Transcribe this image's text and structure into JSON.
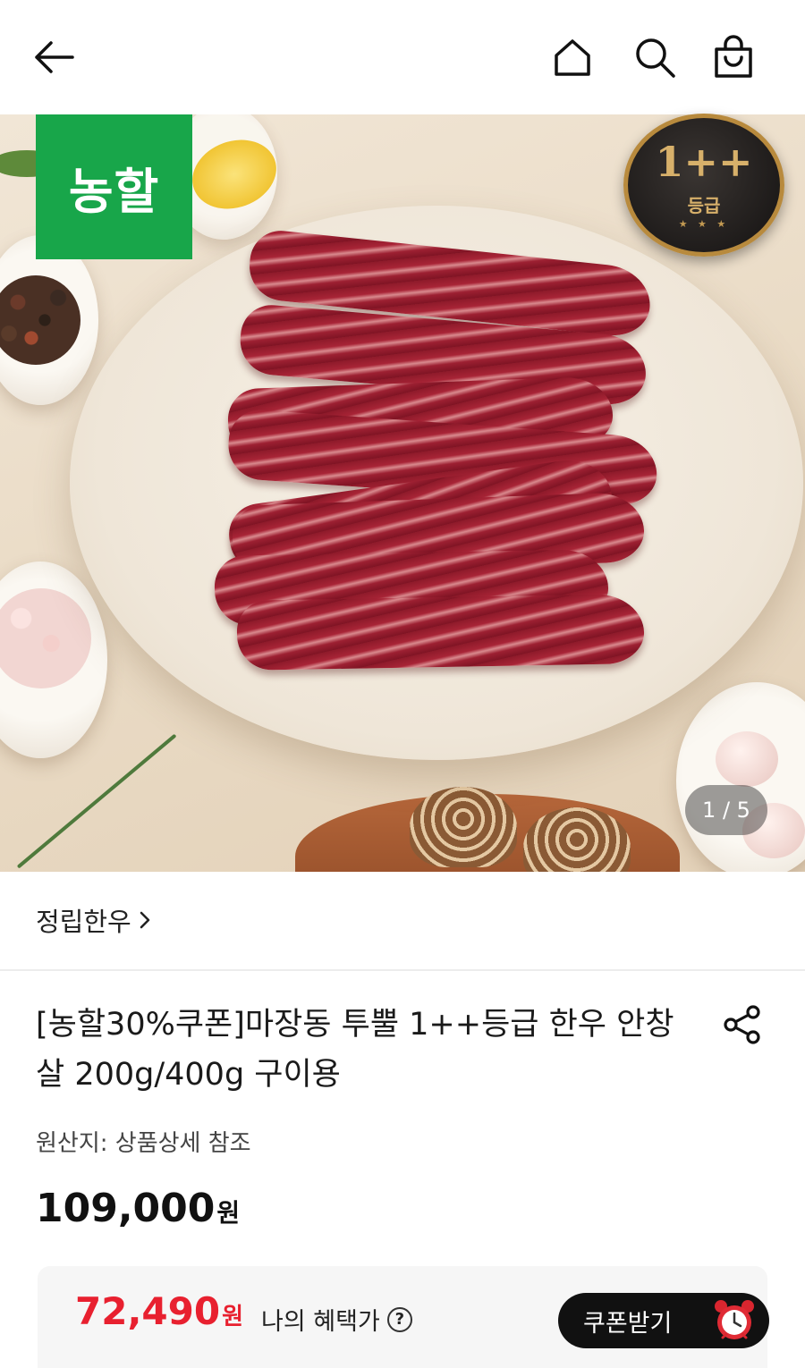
{
  "header": {
    "icons": [
      "back-arrow-icon",
      "home-icon",
      "search-icon",
      "shopping-bag-icon"
    ]
  },
  "hero": {
    "logo_text": "농할",
    "grade_badge_main": "1++",
    "grade_badge_sub": "등급",
    "counter": "1 / 5"
  },
  "product": {
    "seller": "정립한우",
    "title": "[농할30%쿠폰]마장동 투뿔 1++등급 한우 안창살 200g/400g 구이용",
    "origin": "원산지: 상품상세 참조",
    "price": "109,000",
    "price_unit": "원"
  },
  "benefit": {
    "sale_price": "72,490",
    "sale_unit": "원",
    "label": "나의 혜택가",
    "help": "?",
    "coupon_button": "쿠폰받기"
  },
  "colors": {
    "brand_green": "#18a64a",
    "sale_red": "#e8202f",
    "coupon_bg": "#111111"
  }
}
